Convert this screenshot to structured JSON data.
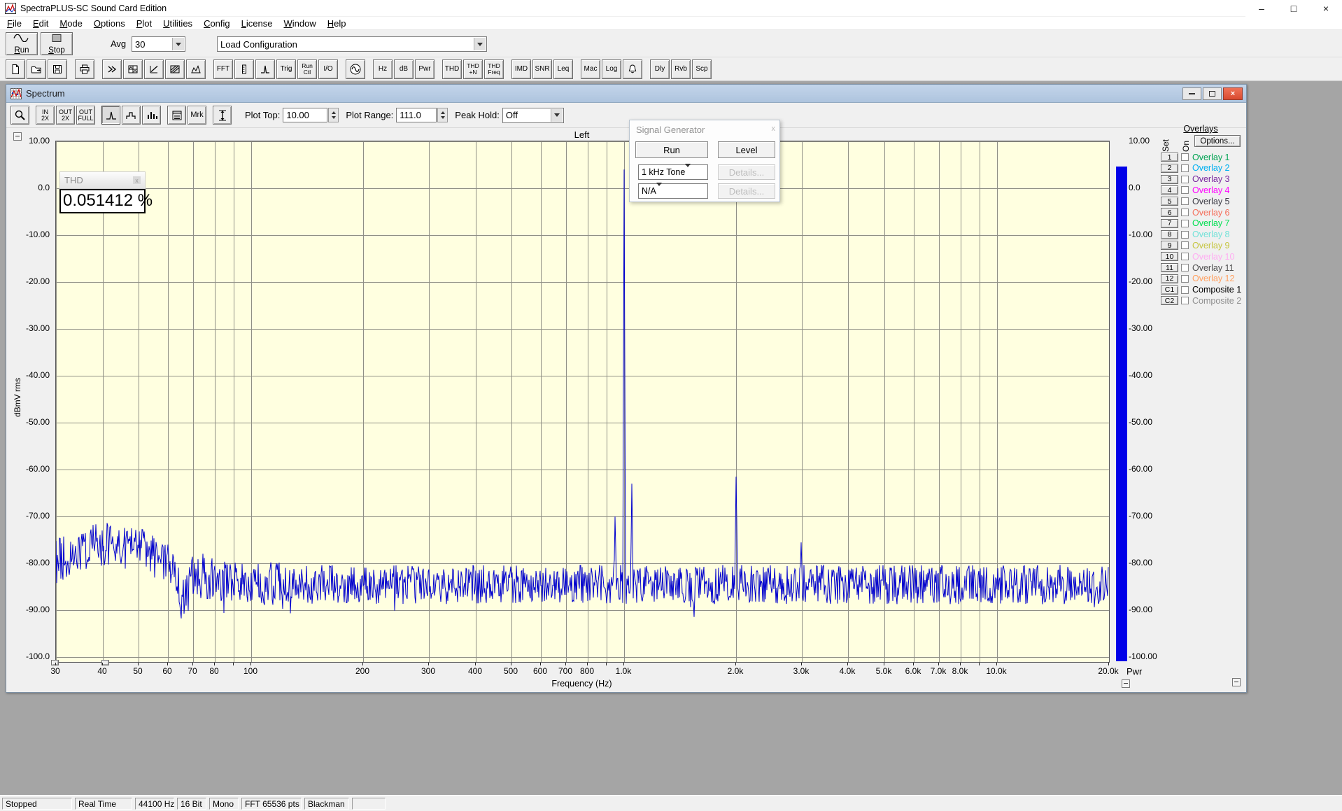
{
  "window": {
    "title": "SpectraPLUS-SC Sound Card Edition",
    "controls": {
      "minimize": "–",
      "maximize": "□",
      "close": "×"
    }
  },
  "menu": {
    "items": [
      "File",
      "Edit",
      "Mode",
      "Options",
      "Plot",
      "Utilities",
      "Config",
      "License",
      "Window",
      "Help"
    ]
  },
  "toolbar_main": {
    "run_label": "Run",
    "stop_label": "Stop",
    "avg_label": "Avg",
    "avg_value": "30",
    "load_config_value": "Load Configuration"
  },
  "toolbar_icons": {
    "groups": [
      {
        "items": [
          {
            "name": "new-file",
            "icon": "page-icon"
          },
          {
            "name": "open-file",
            "icon": "folder-icon"
          },
          {
            "name": "save-file",
            "icon": "floppy-icon"
          }
        ]
      },
      {
        "items": [
          {
            "name": "print",
            "icon": "printer-icon"
          }
        ]
      },
      {
        "items": [
          {
            "name": "view-time-series",
            "icon": "chevrons-icon"
          },
          {
            "name": "view-spectrum",
            "icon": "grid-plot-icon"
          },
          {
            "name": "view-phase",
            "icon": "phase-icon"
          },
          {
            "name": "view-spectrogram",
            "icon": "hatch-icon"
          },
          {
            "name": "view-3d-surface",
            "icon": "surface-icon"
          }
        ]
      },
      {
        "items": [
          {
            "name": "fft-settings",
            "label": "FFT"
          },
          {
            "name": "scaling",
            "icon": "ruler-icon"
          },
          {
            "name": "peak",
            "icon": "spike-icon"
          },
          {
            "name": "trigger",
            "label": "Trig"
          },
          {
            "name": "run-control",
            "lines": [
              "Run",
              "Ctl"
            ]
          },
          {
            "name": "io-device",
            "label": "I/O"
          }
        ]
      },
      {
        "items": [
          {
            "name": "signal-generator",
            "icon": "sine-circle-icon"
          }
        ]
      },
      {
        "items": [
          {
            "name": "units-hz",
            "label": "Hz"
          },
          {
            "name": "units-db",
            "label": "dB"
          },
          {
            "name": "units-pwr",
            "label": "Pwr"
          }
        ]
      },
      {
        "items": [
          {
            "name": "thd",
            "label": "THD"
          },
          {
            "name": "thd-n",
            "lines": [
              "THD",
              "+N"
            ]
          },
          {
            "name": "thd-freq",
            "lines": [
              "THD",
              "Freq"
            ]
          }
        ]
      },
      {
        "items": [
          {
            "name": "imd",
            "label": "IMD"
          },
          {
            "name": "snr",
            "label": "SNR"
          },
          {
            "name": "leq",
            "label": "Leq"
          }
        ]
      },
      {
        "items": [
          {
            "name": "macro",
            "label": "Mac"
          },
          {
            "name": "logging",
            "label": "Log"
          },
          {
            "name": "alarm",
            "icon": "bell-icon"
          }
        ]
      },
      {
        "items": [
          {
            "name": "delay",
            "label": "Dly"
          },
          {
            "name": "reverb",
            "label": "Rvb"
          },
          {
            "name": "scope",
            "label": "Scp"
          }
        ]
      }
    ]
  },
  "spectrum_window": {
    "title": "Spectrum",
    "controls": {
      "minimize": "",
      "maximize": "",
      "close": "×"
    },
    "toolbar": {
      "groups": [
        {
          "items": [
            {
              "name": "zoom",
              "icon": "magnifier-icon"
            }
          ]
        },
        {
          "items": [
            {
              "name": "zoom-in-2x",
              "lines": [
                "IN",
                "2X"
              ]
            },
            {
              "name": "zoom-out-2x",
              "lines": [
                "OUT",
                "2X"
              ]
            },
            {
              "name": "zoom-out-full",
              "lines": [
                "OUT",
                "FULL"
              ]
            }
          ]
        },
        {
          "items": [
            {
              "name": "plot-type-line",
              "icon": "plot-line-icon",
              "pressed": true
            },
            {
              "name": "plot-type-step",
              "icon": "plot-step-icon"
            },
            {
              "name": "plot-type-bar",
              "icon": "plot-bars-icon"
            }
          ]
        },
        {
          "items": [
            {
              "name": "display-options",
              "icon": "options-grid-icon"
            },
            {
              "name": "marker",
              "label": "Mrk"
            }
          ]
        },
        {
          "items": [
            {
              "name": "amplitude-scale",
              "icon": "vruler-icon"
            }
          ]
        }
      ],
      "plot_top_label": "Plot Top:",
      "plot_top_value": "10.00",
      "plot_range_label": "Plot Range:",
      "plot_range_value": "111.0",
      "peak_hold_label": "Peak Hold:",
      "peak_hold_value": "Off"
    },
    "thd_box": {
      "title": "THD",
      "value": "0.051412 %"
    },
    "signal_generator": {
      "title": "Signal Generator",
      "close": "x",
      "run_label": "Run",
      "level_label": "Level",
      "source1_value": "1 kHz Tone",
      "source2_value": "N/A",
      "details1_label": "Details...",
      "details2_label": "Details..."
    },
    "overlays": {
      "heading": "Overlays",
      "col_set": "Set",
      "col_on": "On",
      "options_label": "Options...",
      "rows": [
        {
          "btn": "1",
          "label": "Overlay 1",
          "color": "#00a352"
        },
        {
          "btn": "2",
          "label": "Overlay 2",
          "color": "#00b0f0"
        },
        {
          "btn": "3",
          "label": "Overlay 3",
          "color": "#7a28a0"
        },
        {
          "btn": "4",
          "label": "Overlay 4",
          "color": "#ff00ff"
        },
        {
          "btn": "5",
          "label": "Overlay 5",
          "color": "#3c3c46"
        },
        {
          "btn": "6",
          "label": "Overlay 6",
          "color": "#f4705c"
        },
        {
          "btn": "7",
          "label": "Overlay 7",
          "color": "#00e050"
        },
        {
          "btn": "8",
          "label": "Overlay 8",
          "color": "#72e2d8"
        },
        {
          "btn": "9",
          "label": "Overlay 9",
          "color": "#c6c642"
        },
        {
          "btn": "10",
          "label": "Overlay 10",
          "color": "#ffaef2"
        },
        {
          "btn": "11",
          "label": "Overlay 11",
          "color": "#4f4f4f"
        },
        {
          "btn": "12",
          "label": "Overlay 12",
          "color": "#ffa060"
        },
        {
          "btn": "C1",
          "label": "Composite 1",
          "color": "#000000"
        },
        {
          "btn": "C2",
          "label": "Composite 2",
          "color": "#909090"
        }
      ]
    }
  },
  "chart_data": {
    "type": "line",
    "title": "Left",
    "xlabel": "Frequency (Hz)",
    "ylabel": "dBmV rms",
    "x_scale": "log",
    "xlim": [
      30,
      20000
    ],
    "plot_top": 10,
    "plot_range": 111,
    "background": "#ffffe0",
    "grid_color": "#8f8f85",
    "trace_color": "#0000cd",
    "x_gridlines": [
      30,
      40,
      50,
      60,
      70,
      80,
      90,
      100,
      200,
      300,
      400,
      500,
      600,
      700,
      800,
      900,
      1000,
      2000,
      3000,
      4000,
      5000,
      6000,
      7000,
      8000,
      9000,
      10000,
      20000
    ],
    "x_tick_labels": [
      {
        "f": 30,
        "label": "30"
      },
      {
        "f": 40,
        "label": "40"
      },
      {
        "f": 50,
        "label": "50"
      },
      {
        "f": 60,
        "label": "60"
      },
      {
        "f": 70,
        "label": "70"
      },
      {
        "f": 80,
        "label": "80"
      },
      {
        "f": 100,
        "label": "100"
      },
      {
        "f": 200,
        "label": "200"
      },
      {
        "f": 300,
        "label": "300"
      },
      {
        "f": 400,
        "label": "400"
      },
      {
        "f": 500,
        "label": "500"
      },
      {
        "f": 600,
        "label": "600"
      },
      {
        "f": 700,
        "label": "700"
      },
      {
        "f": 800,
        "label": "800"
      },
      {
        "f": 1000,
        "label": "1.0k"
      },
      {
        "f": 2000,
        "label": "2.0k"
      },
      {
        "f": 3000,
        "label": "3.0k"
      },
      {
        "f": 4000,
        "label": "4.0k"
      },
      {
        "f": 5000,
        "label": "5.0k"
      },
      {
        "f": 6000,
        "label": "6.0k"
      },
      {
        "f": 7000,
        "label": "7.0k"
      },
      {
        "f": 8000,
        "label": "8.0k"
      },
      {
        "f": 10000,
        "label": "10.0k"
      },
      {
        "f": 20000,
        "label": "20.0k"
      }
    ],
    "y_tick_values": [
      10,
      0,
      -10,
      -20,
      -30,
      -40,
      -50,
      -60,
      -70,
      -80,
      -90,
      -100
    ],
    "y_ticks_left": [
      "10.00",
      "0.0",
      "-10.00",
      "-20.00",
      "-30.00",
      "-40.00",
      "-50.00",
      "-60.00",
      "-70.00",
      "-80.00",
      "-90.00",
      "-100.0"
    ],
    "y_ticks_right": [
      "10.00",
      "0.0",
      "-10.00",
      "-20.00",
      "-30.00",
      "-40.00",
      "-50.00",
      "-60.00",
      "-70.00",
      "-80.00",
      "-90.00",
      "-100.00"
    ],
    "noise_floor_dB": -84.5,
    "noise_jitter_dB": 4.2,
    "low_freq_bump": {
      "center_hz": 42,
      "height_dB": 8.5,
      "width_decades": 0.14
    },
    "low_freq_notch": {
      "center_hz": 66,
      "depth_dB": 7,
      "width_decades": 0.012
    },
    "seed": 987654321,
    "peaks": [
      {
        "hz": 1000,
        "level_dB": 4.0
      },
      {
        "hz": 948,
        "level_dB": -70.0
      },
      {
        "hz": 1052,
        "level_dB": -63.0
      },
      {
        "hz": 2000,
        "level_dB": -61.5
      },
      {
        "hz": 2990,
        "level_dB": -75.5
      }
    ],
    "power_bar": {
      "label": "Pwr",
      "color": "#0000e8",
      "top_dB": 4.5
    }
  },
  "status_bar": {
    "fields": [
      "Stopped",
      "Real Time",
      "44100 Hz",
      "16 Bit",
      "Mono",
      "FFT 65536 pts",
      "Blackman",
      ""
    ]
  }
}
